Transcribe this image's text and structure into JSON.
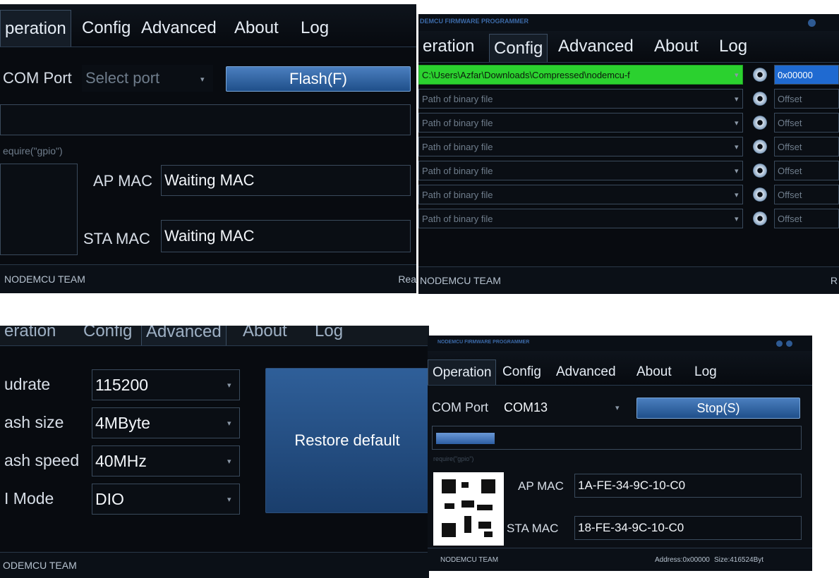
{
  "p1": {
    "tabs": [
      "peration",
      "Config",
      "Advanced",
      "About",
      "Log"
    ],
    "com_label": "COM Port",
    "com_placeholder": "Select port",
    "flash_button": "Flash(F)",
    "hint": "equire(\"gpio\")",
    "ap_mac_label": "AP MAC",
    "ap_mac_value": "Waiting MAC",
    "sta_mac_label": "STA MAC",
    "sta_mac_value": "Waiting MAC",
    "status_left": "NODEMCU TEAM",
    "status_right": "Rea"
  },
  "p2": {
    "title": "DEMCU FIRMWARE PROGRAMMER",
    "tabs": [
      "eration",
      "Config",
      "Advanced",
      "About",
      "Log"
    ],
    "rows": [
      {
        "path": "C:\\Users\\Azfar\\Downloads\\Compressed\\nodemcu-f",
        "offset": "0x00000"
      },
      {
        "path": "Path of binary file",
        "offset": "Offset"
      },
      {
        "path": "Path of binary file",
        "offset": "Offset"
      },
      {
        "path": "Path of binary file",
        "offset": "Offset"
      },
      {
        "path": "Path of binary file",
        "offset": "Offset"
      },
      {
        "path": "Path of binary file",
        "offset": "Offset"
      },
      {
        "path": "Path of binary file",
        "offset": "Offset"
      }
    ],
    "status_left": "NODEMCU TEAM",
    "status_right": "R"
  },
  "p3": {
    "tabs": [
      "eration",
      "Config",
      "Advanced",
      "About",
      "Log"
    ],
    "labels": [
      "udrate",
      "ash size",
      "ash speed",
      "I Mode"
    ],
    "values": [
      "115200",
      "4MByte",
      "40MHz",
      "DIO"
    ],
    "restore_button": "Restore default",
    "status_left": "ODEMCU TEAM"
  },
  "p4": {
    "title": "NODEMCU FIRMWARE PROGRAMMER",
    "tabs": [
      "Operation",
      "Config",
      "Advanced",
      "About",
      "Log"
    ],
    "com_label": "COM Port",
    "com_value": "COM13",
    "stop_button": "Stop(S)",
    "progress": 0.16,
    "hint": "require(\"gpio\")",
    "ap_mac_label": "AP MAC",
    "ap_mac_value": "1A-FE-34-9C-10-C0",
    "sta_mac_label": "STA MAC",
    "sta_mac_value": "18-FE-34-9C-10-C0",
    "status_left": "NODEMCU TEAM",
    "status_addr": "Address:0x00000",
    "status_size": "Size:416524Byt"
  }
}
